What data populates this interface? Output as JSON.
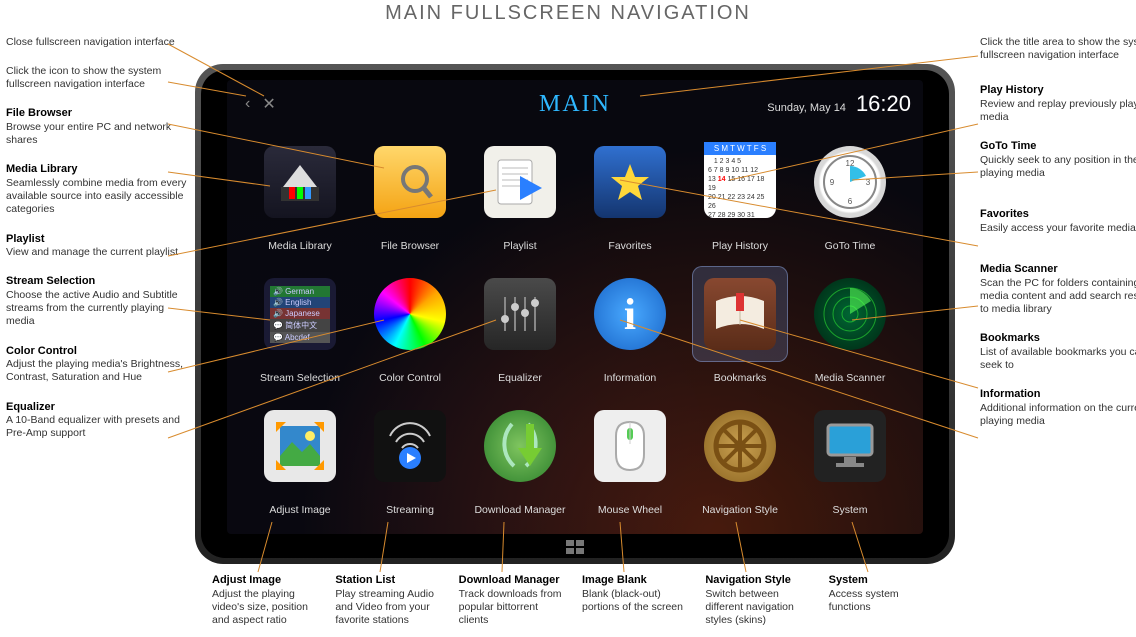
{
  "page_title": "MAIN FULLSCREEN NAVIGATION",
  "screen": {
    "title": "MAIN",
    "date": "Sunday, May 14",
    "time": "16:20"
  },
  "apps": [
    {
      "label": "Media Library"
    },
    {
      "label": "File Browser"
    },
    {
      "label": "Playlist"
    },
    {
      "label": "Favorites"
    },
    {
      "label": "Play History"
    },
    {
      "label": "GoTo Time"
    },
    {
      "label": "Stream Selection"
    },
    {
      "label": "Color Control"
    },
    {
      "label": "Equalizer"
    },
    {
      "label": "Information"
    },
    {
      "label": "Bookmarks"
    },
    {
      "label": "Media Scanner"
    },
    {
      "label": "Adjust Image"
    },
    {
      "label": "Streaming"
    },
    {
      "label": "Download Manager"
    },
    {
      "label": "Mouse Wheel"
    },
    {
      "label": "Navigation Style"
    },
    {
      "label": "System"
    }
  ],
  "notes_left": [
    {
      "t": "",
      "d": "Close fullscreen navigation interface"
    },
    {
      "t": "",
      "d": "Click the icon to show the system fullscreen navigation interface"
    },
    {
      "t": "File Browser",
      "d": "Browse your entire PC and network shares"
    },
    {
      "t": "Media Library",
      "d": "Seamlessly combine media from every available source into easily accessible categories"
    },
    {
      "t": "Playlist",
      "d": "View and manage the current playlist"
    },
    {
      "t": "Stream Selection",
      "d": "Choose the active Audio and Subtitle streams from the currently playing media"
    },
    {
      "t": "Color Control",
      "d": "Adjust the playing media's Brightness, Contrast, Saturation and Hue"
    },
    {
      "t": "Equalizer",
      "d": "A 10-Band equalizer with presets and Pre-Amp support"
    }
  ],
  "notes_right": [
    {
      "t": "",
      "d": "Click the title area to show the system fullscreen navigation interface"
    },
    {
      "t": "Play History",
      "d": "Review and replay previously played media"
    },
    {
      "t": "GoTo Time",
      "d": "Quickly seek to any position in the playing media"
    },
    {
      "t": "Favorites",
      "d": "Easily access your favorite media"
    },
    {
      "t": "Media Scanner",
      "d": "Scan the PC for folders containing media content and add search results to media library"
    },
    {
      "t": "Bookmarks",
      "d": "List of available bookmarks you can seek to"
    },
    {
      "t": "Information",
      "d": "Additional information on the currently playing media"
    }
  ],
  "notes_bottom": [
    {
      "t": "Adjust Image",
      "d": "Adjust the playing video's size, position and aspect ratio"
    },
    {
      "t": "Station List",
      "d": "Play streaming Audio and Video from your favorite stations"
    },
    {
      "t": "Download Manager",
      "d": "Track downloads from popular bittorrent clients"
    },
    {
      "t": "Image Blank",
      "d": "Blank (black-out) portions of the screen"
    },
    {
      "t": "Navigation Style",
      "d": "Switch between different navigation styles (skins)"
    },
    {
      "t": "System",
      "d": "Access system functions"
    }
  ]
}
